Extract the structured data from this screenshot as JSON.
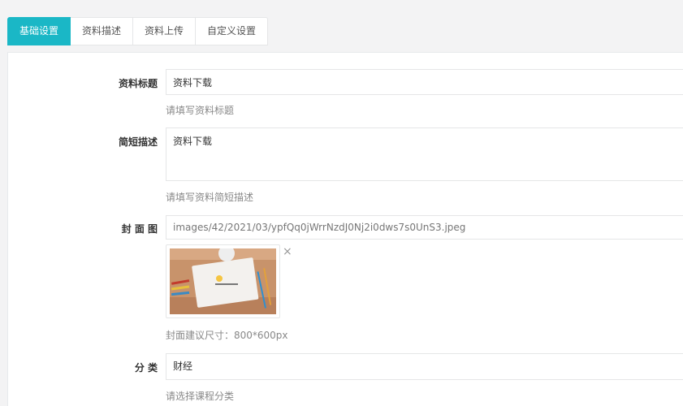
{
  "tabs": [
    {
      "label": "基础设置",
      "active": true
    },
    {
      "label": "资料描述",
      "active": false
    },
    {
      "label": "资料上传",
      "active": false
    },
    {
      "label": "自定义设置",
      "active": false
    }
  ],
  "form": {
    "title": {
      "label": "资料标题",
      "value": "资料下载",
      "help": "请填写资料标题"
    },
    "summary": {
      "label": "简短描述",
      "value": "资料下载",
      "help": "请填写资料简短描述"
    },
    "cover": {
      "label": "封 面 图",
      "value": "images/42/2021/03/ypfQq0jWrrNzdJ0Nj2i0dws7s0UnS3.jpeg",
      "help": "封面建议尺寸：800*600px",
      "remove_symbol": "×"
    },
    "category": {
      "label": "分 类",
      "value": "财经",
      "help": "请选择课程分类"
    }
  },
  "colors": {
    "accent": "#1ab7c6"
  }
}
